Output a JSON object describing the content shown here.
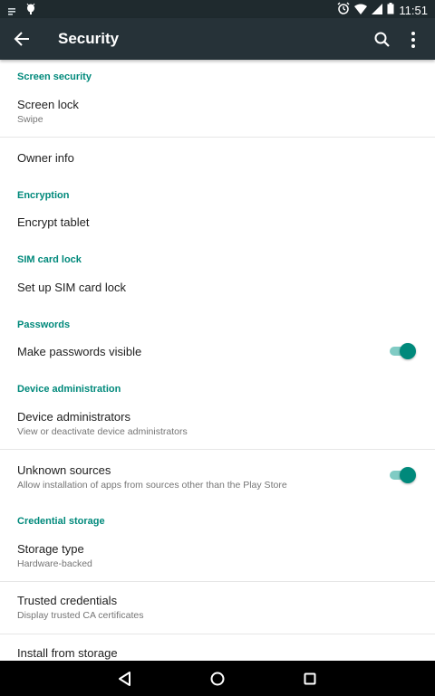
{
  "status_bar": {
    "time": "11:51",
    "left_icons": [
      "notification-icon",
      "android-debug-icon"
    ],
    "right_icons": [
      "alarm-icon",
      "wifi-icon",
      "signal-icon",
      "battery-icon"
    ]
  },
  "toolbar": {
    "title": "Security",
    "back_icon": "arrow-back-icon",
    "search_icon": "search-icon",
    "more_icon": "more-vert-icon"
  },
  "sections": [
    {
      "category": "Screen security"
    },
    {
      "category": "Encryption"
    },
    {
      "category": "SIM card lock"
    },
    {
      "category": "Passwords"
    },
    {
      "category": "Device administration"
    },
    {
      "category": "Credential storage"
    }
  ],
  "prefs": {
    "screen_lock": {
      "title": "Screen lock",
      "summary": "Swipe"
    },
    "owner_info": {
      "title": "Owner info"
    },
    "encrypt_tablet": {
      "title": "Encrypt tablet"
    },
    "sim_lock": {
      "title": "Set up SIM card lock"
    },
    "passwords_visible": {
      "title": "Make passwords visible",
      "checked": true
    },
    "device_admins": {
      "title": "Device administrators",
      "summary": "View or deactivate device administrators"
    },
    "unknown_sources": {
      "title": "Unknown sources",
      "summary": "Allow installation of apps from sources other than the Play Store",
      "checked": true
    },
    "storage_type": {
      "title": "Storage type",
      "summary": "Hardware-backed"
    },
    "trusted_credentials": {
      "title": "Trusted credentials",
      "summary": "Display trusted CA certificates"
    },
    "install_from_storage": {
      "title": "Install from storage"
    }
  },
  "colors": {
    "accent": "#00897b",
    "toolbar": "#263238",
    "status_bar": "#1f2a2e"
  },
  "nav_bar": {
    "buttons": [
      "back-triangle-icon",
      "home-circle-icon",
      "recents-square-icon"
    ]
  }
}
